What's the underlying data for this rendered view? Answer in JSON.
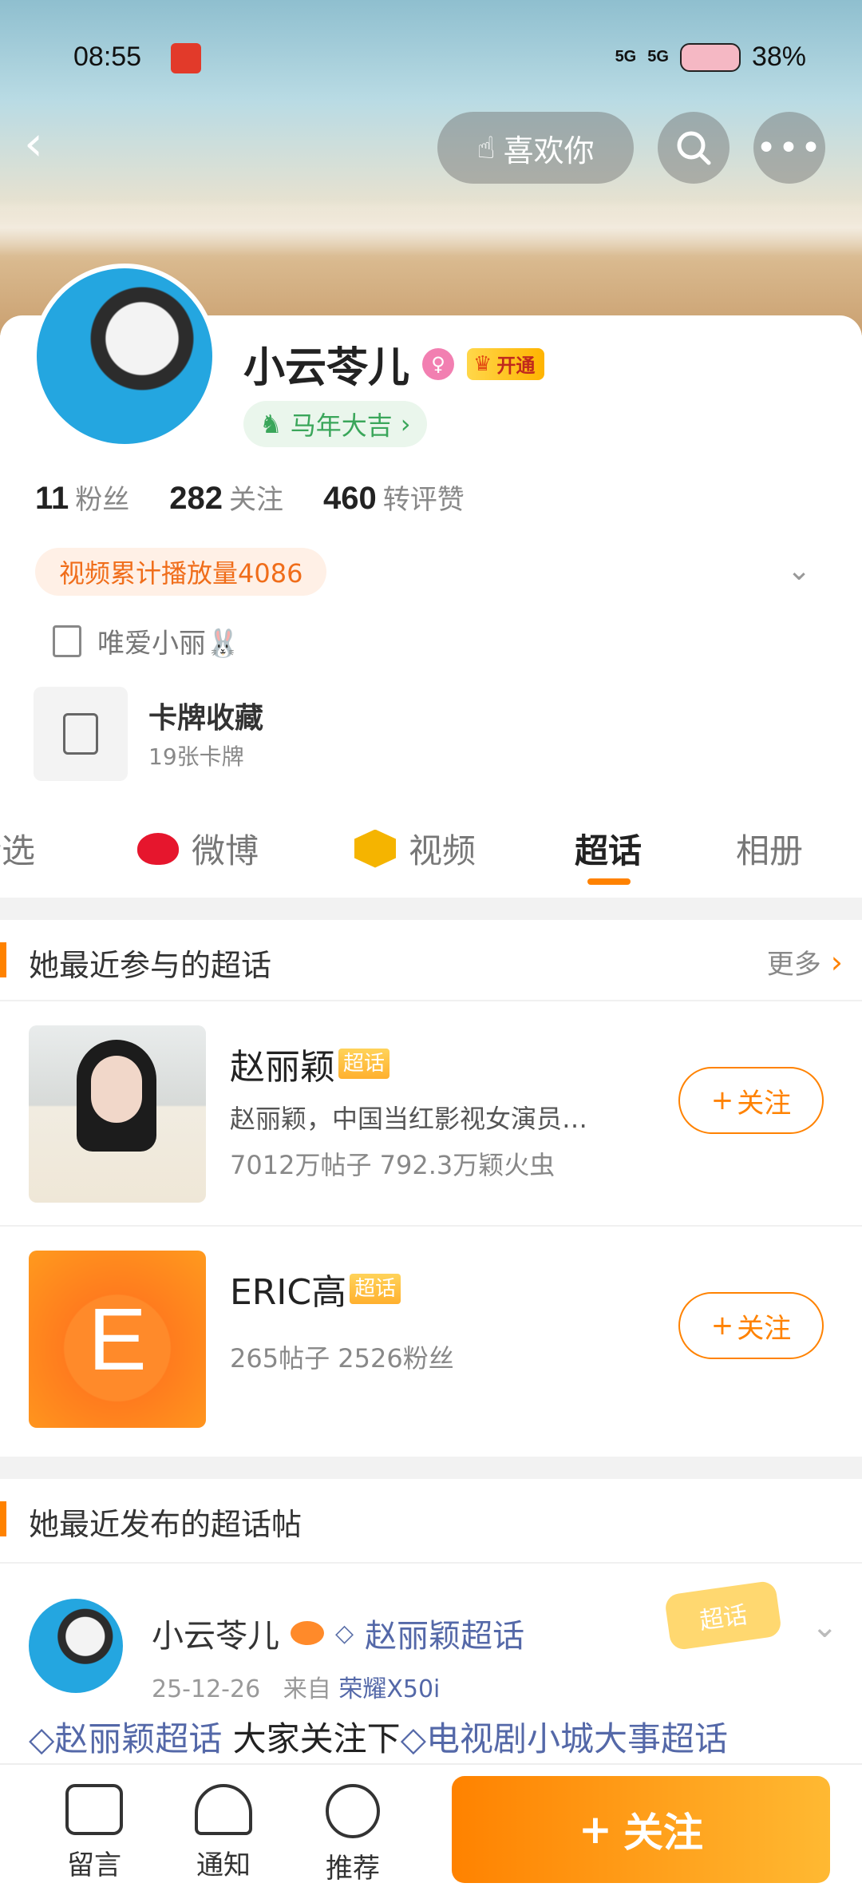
{
  "status_bar": {
    "time": "08:55",
    "signal_1": "5G",
    "signal_2": "5G",
    "battery": "38%"
  },
  "header": {
    "like_label": "喜欢你"
  },
  "profile": {
    "name": "小云苓儿",
    "vip_label": "开通",
    "tag": "马年大吉",
    "stats": [
      {
        "num": "11",
        "label": "粉丝"
      },
      {
        "num": "282",
        "label": "关注"
      },
      {
        "num": "460",
        "label": "转评赞"
      }
    ],
    "video_plays": "视频累计播放量4086",
    "bio": "唯爱小丽🐰",
    "cards": {
      "title": "卡牌收藏",
      "sub": "19张卡牌"
    }
  },
  "tabs": [
    {
      "label": "精选"
    },
    {
      "label": "微博"
    },
    {
      "label": "视频"
    },
    {
      "label": "超话"
    },
    {
      "label": "相册"
    }
  ],
  "section_topics": {
    "title": "她最近参与的超话",
    "more": "更多",
    "items": [
      {
        "name": "赵丽颖",
        "tag": "超话",
        "desc": "赵丽颖，中国当红影视女演员…",
        "meta": "7012万帖子 792.3万颖火虫",
        "follow": "关注"
      },
      {
        "name": "ERIC高",
        "tag": "超话",
        "letter": "E",
        "meta": "265帖子 2526粉丝",
        "follow": "关注"
      }
    ]
  },
  "section_posts": {
    "title": "她最近发布的超话帖",
    "post": {
      "author": "小云苓儿",
      "topic": "赵丽颖超话",
      "date": "25-12-26",
      "from_label": "来自",
      "device": "荣耀X50i",
      "sticker": "超话",
      "text_link_1": "赵丽颖超话",
      "text_mid": " 大家关注下",
      "text_link_2": "电视剧小城大事超话"
    }
  },
  "bottom_bar": {
    "message": "留言",
    "notify": "通知",
    "recommend": "推荐",
    "follow": "关注"
  },
  "colors": {
    "accent": "#ff8200",
    "link": "#5468a8",
    "weibo_red": "#e6162d"
  }
}
